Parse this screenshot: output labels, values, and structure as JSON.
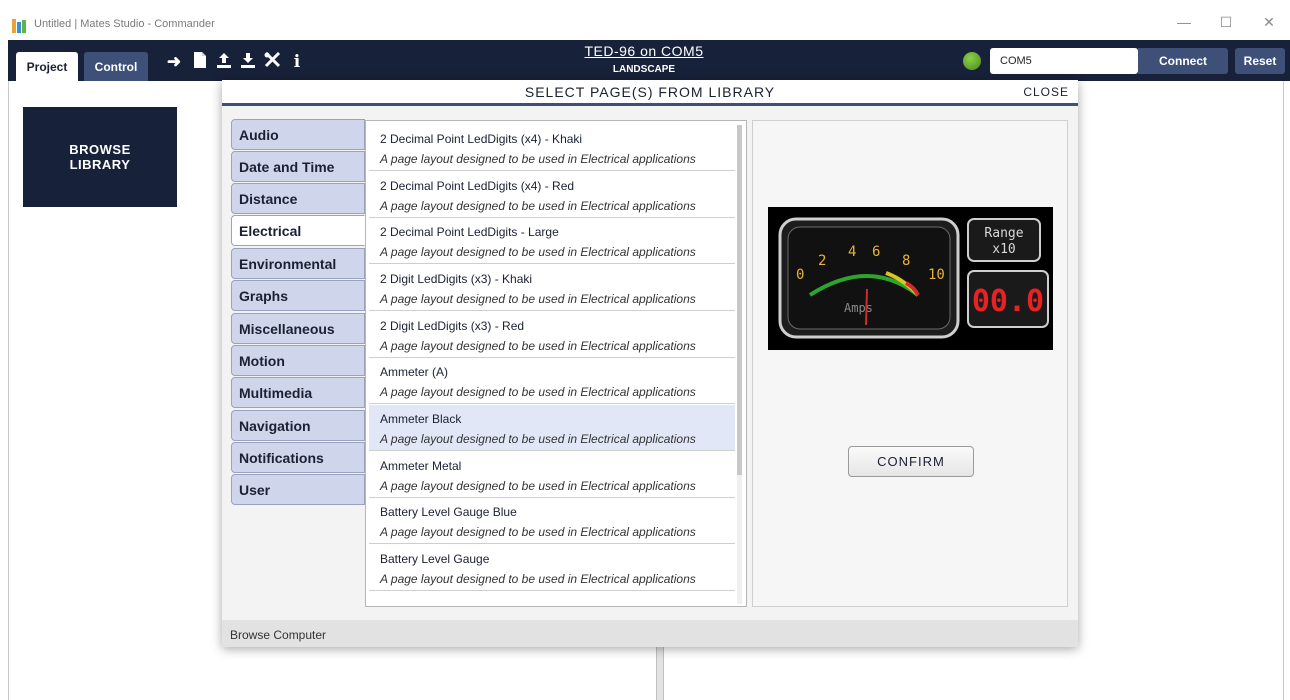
{
  "window": {
    "title": "Untitled | Mates Studio - Commander",
    "minimize": "—",
    "maximize": "☐",
    "close": "✕"
  },
  "toolbar": {
    "tabs": [
      "Project",
      "Control"
    ],
    "icons": [
      "arrow-right-icon",
      "new-file-icon",
      "upload-icon",
      "download-icon",
      "tools-icon",
      "info-icon"
    ],
    "device_title": "TED-96 on COM5",
    "device_orientation": "LANDSCAPE",
    "com_port": "COM5",
    "connect_label": "Connect",
    "reset_label": "Reset",
    "status_color": "#6ab42a"
  },
  "sidebar": {
    "browse_library_line1": "BROWSE",
    "browse_library_line2": "LIBRARY"
  },
  "modal": {
    "title": "SELECT PAGE(S) FROM LIBRARY",
    "close_label": "CLOSE",
    "categories": [
      "Audio",
      "Date and Time",
      "Distance",
      "Electrical",
      "Environmental",
      "Graphs",
      "Miscellaneous",
      "Motion",
      "Multimedia",
      "Navigation",
      "Notifications",
      "User"
    ],
    "active_category": "Electrical",
    "items": [
      {
        "title": "2 Decimal Point LedDigits (x4) - Khaki",
        "desc": "A page layout designed to be used in Electrical applications"
      },
      {
        "title": "2 Decimal Point LedDigits (x4) - Red",
        "desc": "A page layout designed to be used in Electrical applications"
      },
      {
        "title": "2 Decimal Point LedDigits - Large",
        "desc": "A page layout designed to be used in Electrical applications"
      },
      {
        "title": "2 Digit LedDigits (x3) - Khaki",
        "desc": "A page layout designed to be used in Electrical applications"
      },
      {
        "title": "2 Digit LedDigits (x3) - Red",
        "desc": "A page layout designed to be used in Electrical applications"
      },
      {
        "title": "Ammeter (A)",
        "desc": "A page layout designed to be used in Electrical applications"
      },
      {
        "title": "Ammeter Black",
        "desc": "A page layout designed to be used in Electrical applications"
      },
      {
        "title": "Ammeter Metal",
        "desc": "A page layout designed to be used in Electrical applications"
      },
      {
        "title": "Battery Level Gauge Blue",
        "desc": "A page layout designed to be used in Electrical applications"
      },
      {
        "title": "Battery Level Gauge",
        "desc": "A page layout designed to be used in Electrical applications"
      }
    ],
    "selected_item": "Ammeter Black",
    "preview": {
      "scale_labels": [
        "0",
        "2",
        "4",
        "6",
        "8",
        "10"
      ],
      "unit_label": "Amps",
      "range_label": "Range",
      "range_value": "x10",
      "digits": "00.0"
    },
    "confirm_label": "CONFIRM",
    "footer_label": "Browse Computer"
  },
  "colors": {
    "navy": "#18213a",
    "accent": "#3e4f78",
    "tab_bg": "#cfd6ec",
    "selected_row": "#e1e7f6"
  }
}
